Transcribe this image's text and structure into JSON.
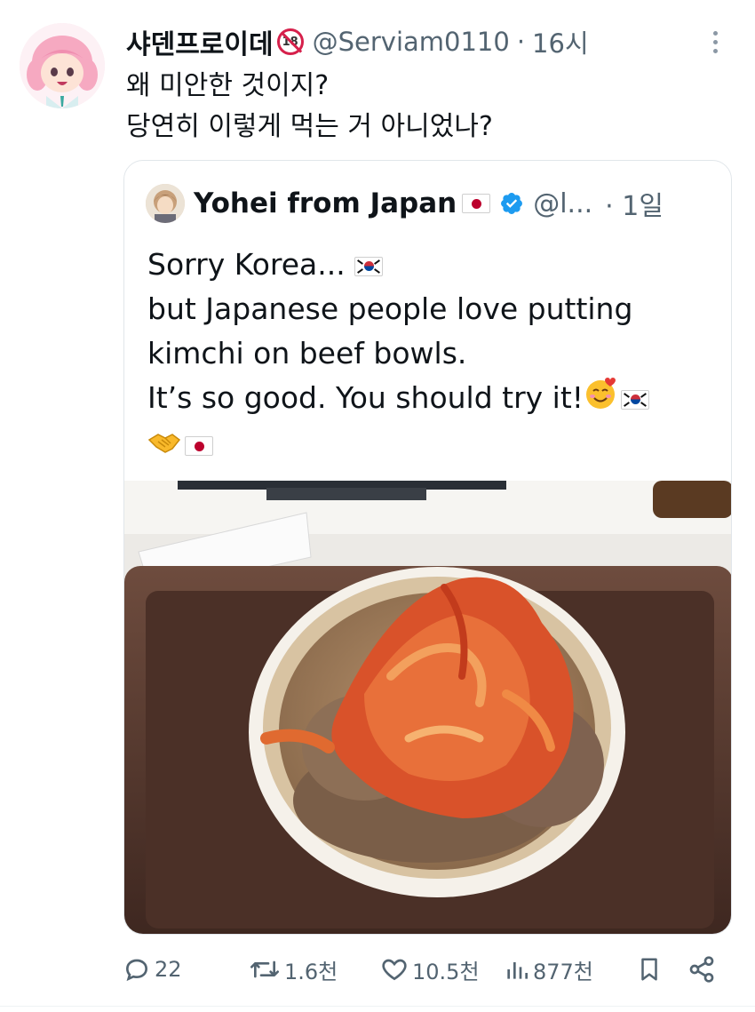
{
  "tweet": {
    "display_name": "샤덴프로이데",
    "adult_badge": "18",
    "handle": "@Serviam0110",
    "separator": "·",
    "time": "16시",
    "text_lines": [
      "왜 미안한 것이지?",
      "당연히 이렇게 먹는 거 아니었나?"
    ]
  },
  "quote": {
    "display_name": "Yohei from Japan",
    "handle": "@l...",
    "separator": "·",
    "time": "1일",
    "lines": [
      "Sorry Korea...",
      "but Japanese people love putting",
      "kimchi on beef bowls.",
      "It’s so good. You should try it!"
    ],
    "image_alt": "beef bowl topped with kimchi on a brown tray"
  },
  "actions": {
    "replies": "22",
    "reposts": "1.6천",
    "likes": "10.5천",
    "views": "877천"
  },
  "colors": {
    "text": "#0f1419",
    "muted": "#536471",
    "verified": "#1d9bf0",
    "border": "#e1e6ea"
  },
  "icons": [
    "more-icon",
    "verified-badge-icon",
    "reply-icon",
    "repost-icon",
    "like-icon",
    "views-icon",
    "bookmark-icon",
    "share-icon",
    "flag-korea-icon",
    "flag-japan-icon",
    "smiling-face-with-hearts-icon",
    "handshake-icon",
    "adult-content-icon"
  ]
}
